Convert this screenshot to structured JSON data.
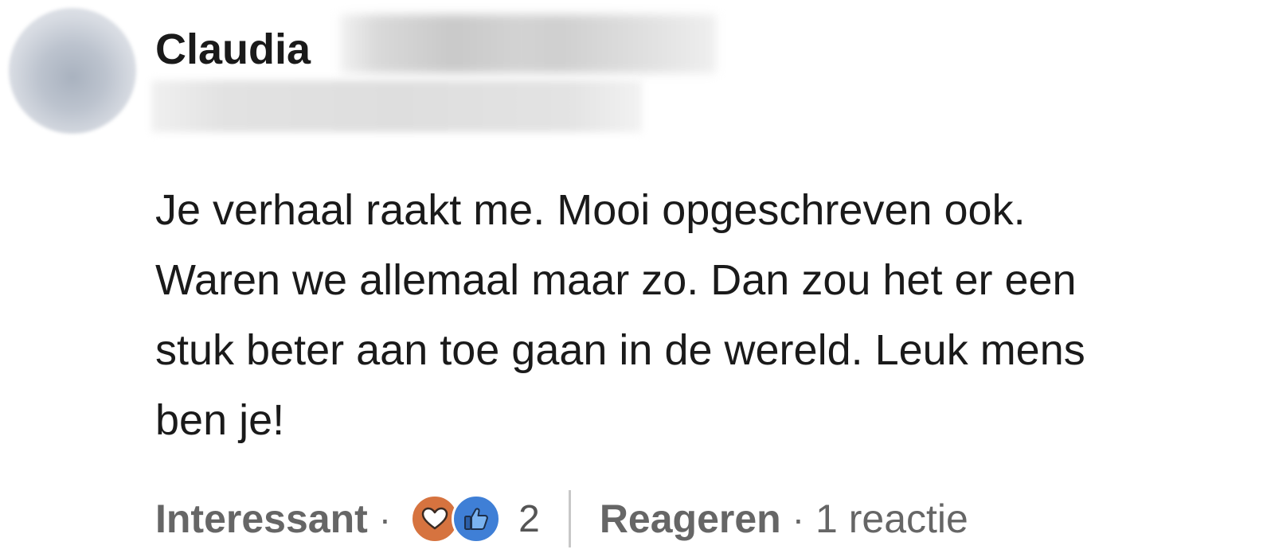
{
  "comment": {
    "author_first_name": "Claudia",
    "body_lines": [
      "Je verhaal raakt me. Mooi opgeschreven ook.",
      "Waren we allemaal maar zo. Dan zou het er een",
      "stuk beter aan toe gaan in de wereld. Leuk mens",
      "ben je!"
    ]
  },
  "actions": {
    "interesting_label": "Interessant",
    "separator": "·",
    "reaction_count": "2",
    "reply_label": "Reageren",
    "reply_count_label": "1 reactie"
  },
  "reactions": {
    "icons": [
      "heart-icon",
      "thumbs-up-icon"
    ],
    "colors": {
      "love": "#d6733f",
      "like": "#3f7fd6"
    }
  }
}
